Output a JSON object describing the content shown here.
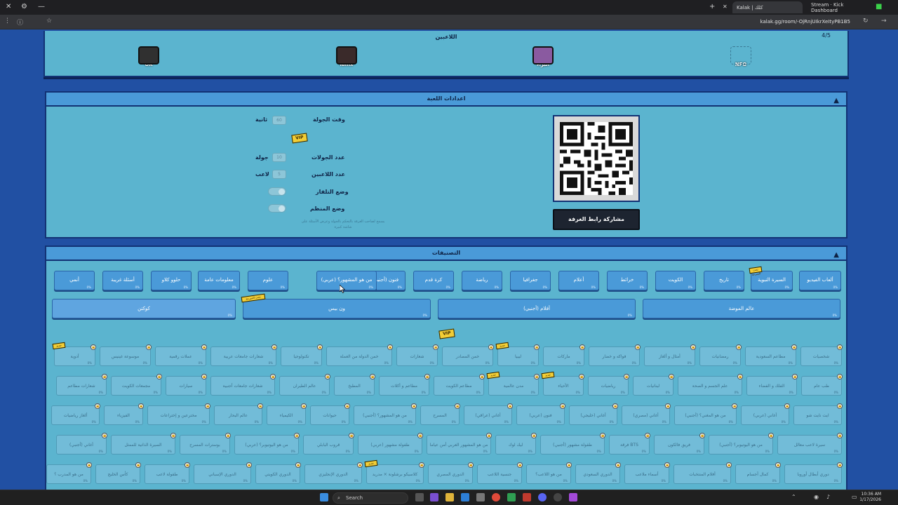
{
  "browser": {
    "tabs": [
      {
        "label": "Kalak | كلك",
        "active": true
      },
      {
        "label": "Stream · Kick Dashboard",
        "active": false
      }
    ],
    "url": "kalak.gg/room/-OjRnjUIkrXeItyPB1B5"
  },
  "players": {
    "title": "اللاعبين",
    "count": "4/5",
    "list": [
      {
        "name": "OK"
      },
      {
        "name": "lamx"
      },
      {
        "name": "البراء"
      },
      {
        "name": "NFO"
      }
    ]
  },
  "settings": {
    "title": "اعدادات اللعبة",
    "round_time_label": "وقت الجولة",
    "round_time_value": "60",
    "round_time_unit": "ثانية",
    "vip_badge": "VIP",
    "rounds_label": "عدد الجولات",
    "rounds_value": "10",
    "rounds_unit": "جولة",
    "players_label": "عدد اللاعبين",
    "players_value": "5",
    "players_unit": "لاعب",
    "tv_mode_label": "وضع التلفاز",
    "host_mode_label": "وضع المنظم",
    "note": "يسمح لصاحب الغرفة بالتحكم بالجولة وعرض الأسئلة على شاشة كبيرة",
    "share_button": "مشاركة رابط الغرفة"
  },
  "categories": {
    "title": "التصنيفات",
    "vip_badge": "VIP",
    "row1": [
      {
        "label": "ألعاب الفيديو",
        "pct": "0%"
      },
      {
        "label": "السيرة النبوية",
        "pct": "0%",
        "tag": "تحت السرعة"
      },
      {
        "label": "تاريخ",
        "pct": "0%"
      },
      {
        "label": "الكويت",
        "pct": "0%"
      },
      {
        "label": "خرائط",
        "pct": "0%"
      },
      {
        "label": "أعلام",
        "pct": "0%"
      },
      {
        "label": "جغرافيا",
        "pct": "0%"
      },
      {
        "label": "رياضة",
        "pct": "0%"
      },
      {
        "label": "كرة قدم",
        "pct": "0%"
      },
      {
        "label": "فنون (أجنبي)",
        "pct": "0%"
      },
      {
        "label": "من هو المشهور؟ (عربي)",
        "pct": "0%"
      },
      {
        "label": "علوم",
        "pct": "0%"
      },
      {
        "label": "معلومات عامة",
        "pct": "0%"
      },
      {
        "label": "حلوو كلاو",
        "pct": "0%"
      },
      {
        "label": "أسئلة غريبة",
        "pct": "0%"
      },
      {
        "label": "أنمي",
        "pct": "0%"
      }
    ],
    "row2": [
      {
        "label": "عالم الموضة",
        "pct": "0%"
      },
      {
        "label": "أفلام (أجنبي)",
        "pct": "0%"
      },
      {
        "label": "ون بيس",
        "pct": "0%",
        "tag": "تحت السرعة"
      },
      {
        "label": "كوكتن",
        "pct": "0%"
      }
    ],
    "locked": [
      [
        {
          "label": "شخصيات",
          "pct": "0%"
        },
        {
          "label": "مطاعم السعودية",
          "pct": "0%"
        },
        {
          "label": "رمضانيات",
          "pct": "0%"
        },
        {
          "label": "أمثال و ألغاز",
          "pct": "0%"
        },
        {
          "label": "فواكه و خضار",
          "pct": "0%"
        },
        {
          "label": "ماركات",
          "pct": "0%"
        },
        {
          "label": "ليبيا",
          "pct": "0%",
          "tag": "جديد"
        },
        {
          "label": "خمن المصادر",
          "pct": "0%"
        },
        {
          "label": "شعارات",
          "pct": "0%"
        },
        {
          "label": "خمن الدولة من العملة",
          "pct": "0%"
        },
        {
          "label": "تكنولوجيا",
          "pct": "0%"
        },
        {
          "label": "شعارات جامعات عربية",
          "pct": "0%"
        },
        {
          "label": "عملات رقمية",
          "pct": "0%"
        },
        {
          "label": "موسوعة غينيس",
          "pct": "0%"
        },
        {
          "label": "أدوية",
          "pct": "0%",
          "tag": "جديد"
        }
      ],
      [
        {
          "label": "طب عام",
          "pct": "0%"
        },
        {
          "label": "الفلك و الفضاء",
          "pct": "0%"
        },
        {
          "label": "علم الجسم و الصحة",
          "pct": "0%"
        },
        {
          "label": "لبنانيات",
          "pct": "0%"
        },
        {
          "label": "رياضيات",
          "pct": "0%"
        },
        {
          "label": "الأحياء",
          "pct": "0%",
          "tag": "جديد"
        },
        {
          "label": "مدن عالمية",
          "pct": "0%",
          "tag": "جديد"
        },
        {
          "label": "مطاعم الكويت",
          "pct": "0%"
        },
        {
          "label": "مطاعم و أكلات",
          "pct": "0%"
        },
        {
          "label": "المطبخ",
          "pct": "0%"
        },
        {
          "label": "عالم الطيران",
          "pct": "0%"
        },
        {
          "label": "شعارات جامعات أجنبية",
          "pct": "0%"
        },
        {
          "label": "سيارات",
          "pct": "0%"
        },
        {
          "label": "مجمعات الكويت",
          "pct": "0%"
        },
        {
          "label": "شعارات مطاعم",
          "pct": "0%"
        }
      ],
      [
        {
          "label": "ايت نايت شو",
          "pct": "0%"
        },
        {
          "label": "أغاني (عربي)",
          "pct": "0%"
        },
        {
          "label": "من هو المغني؟ (أجنبي)",
          "pct": "0%"
        },
        {
          "label": "أغاني (مصري)",
          "pct": "0%"
        },
        {
          "label": "أغاني (خليجي)",
          "pct": "0%"
        },
        {
          "label": "فنون (عربي)",
          "pct": "0%"
        },
        {
          "label": "أغاني (عراقي)",
          "pct": "0%"
        },
        {
          "label": "المسرح",
          "pct": "0%"
        },
        {
          "label": "من هو المشهور؟ (أجنبي)",
          "pct": "0%"
        },
        {
          "label": "حيوانات",
          "pct": "0%"
        },
        {
          "label": "الكيمياء",
          "pct": "0%"
        },
        {
          "label": "عالم البحار",
          "pct": "0%"
        },
        {
          "label": "مخترعين و إختراعات",
          "pct": "0%"
        },
        {
          "label": "الفيزياء",
          "pct": "0%"
        },
        {
          "label": "ألغاز رياضيات",
          "pct": "0%"
        }
      ],
      [
        {
          "label": "سيرة لاعب معالل",
          "pct": "0%"
        },
        {
          "label": "من هو اليوتيوبر؟ (أجنبي)",
          "pct": "0%"
        },
        {
          "label": "فريق فالكون",
          "pct": "0%"
        },
        {
          "label": "فرقة BTS",
          "pct": "0%"
        },
        {
          "label": "طفولة مشهور (أجنبي)",
          "pct": "0%"
        },
        {
          "label": "ليك لوك",
          "pct": "0%"
        },
        {
          "label": "من هو المشهور العربي أمن عياما",
          "pct": "0%"
        },
        {
          "label": "طفولة مشهور (عربي)",
          "pct": "0%"
        },
        {
          "label": "قروب البابلي",
          "pct": "0%"
        },
        {
          "label": "من هو اليوتيوبر؟ (عربي)",
          "pct": "0%"
        },
        {
          "label": "بوسترات المسرح",
          "pct": "0%"
        },
        {
          "label": "السيرة الذاتية للممثل",
          "pct": "0%"
        },
        {
          "label": "أغاني (أجنبي)",
          "pct": "0%"
        }
      ],
      [
        {
          "label": "دوري أبطال أوروبا",
          "pct": "0%"
        },
        {
          "label": "كمال أجسام",
          "pct": "0%"
        },
        {
          "label": "أفلام المنتخبات",
          "pct": "0%"
        },
        {
          "label": "أسماء ملاعب",
          "pct": "0%"
        },
        {
          "label": "الدوري السعودي",
          "pct": "0%"
        },
        {
          "label": "من هو اللاعب؟",
          "pct": "0%"
        },
        {
          "label": "جنسية اللاعب",
          "pct": "0%"
        },
        {
          "label": "الدوري المصري",
          "pct": "0%"
        },
        {
          "label": "كلاسيكو برشلونة × مدريد",
          "pct": "0%",
          "tag": "جديد"
        },
        {
          "label": "الدوري الإنجليزي",
          "pct": "0%"
        },
        {
          "label": "الدوري الكويتي",
          "pct": "0%"
        },
        {
          "label": "الدوري الإسباني",
          "pct": "0%"
        },
        {
          "label": "طفولة لاعب",
          "pct": "0%"
        },
        {
          "label": "كأس الخليج",
          "pct": "0%"
        },
        {
          "label": "من هو المدرب ؟",
          "pct": "0%"
        }
      ]
    ]
  },
  "taskbar": {
    "search_placeholder": "Search",
    "time": "10:36 AM",
    "date": "1/17/2026"
  }
}
